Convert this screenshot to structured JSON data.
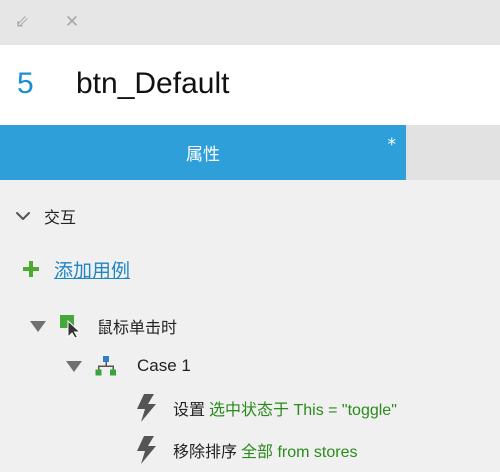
{
  "window": {
    "icons": [
      "shrink-icon",
      "close-icon"
    ],
    "shrink_glyph": "⇙",
    "close_glyph": "✕"
  },
  "widget": {
    "number": "5",
    "name": "btn_Default"
  },
  "tabs": {
    "active_label": "属性",
    "modified_marker": "*"
  },
  "interactions": {
    "section_label": "交互",
    "add_case_label": "添加用例",
    "event": {
      "label": "鼠标单击时"
    },
    "case": {
      "label": "Case 1"
    },
    "actions": [
      {
        "verb": "设置",
        "detail": "选中状态于 This = \"toggle\""
      },
      {
        "verb": "移除排序",
        "detail": "全部 from stores"
      }
    ]
  },
  "colors": {
    "accent": "#2e9fd9",
    "link": "#1f86c2",
    "widget_number": "#1a8fd0",
    "action_detail": "#2a8a1c",
    "add_icon": "#4caa2e"
  }
}
